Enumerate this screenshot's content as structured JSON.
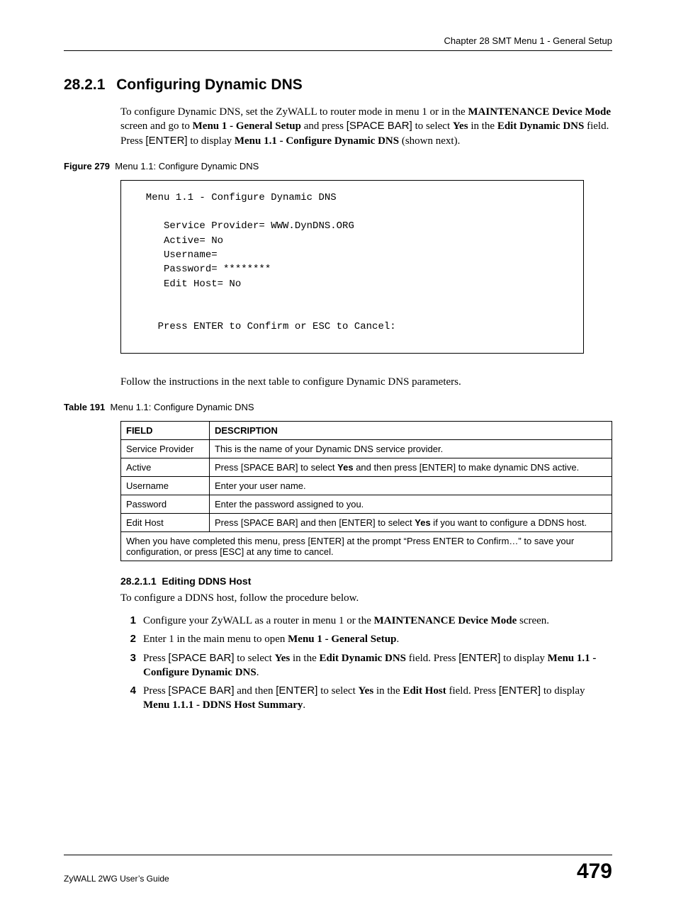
{
  "header": {
    "chapter": "Chapter 28 SMT Menu 1 - General Setup"
  },
  "section": {
    "number": "28.2.1",
    "title": "Configuring Dynamic DNS"
  },
  "intro": {
    "p1a": "To configure Dynamic DNS, set the ZyWALL to router mode in menu 1 or in the ",
    "p1b": "MAINTENANCE Device Mode",
    "p1c": " screen and go to ",
    "p1d": "Menu 1 - General Setup",
    "p1e": " and press ",
    "p1f": "[SPACE BAR]",
    "p1g": " to select ",
    "p1h": "Yes",
    "p1i": " in the ",
    "p1j": "Edit Dynamic DNS",
    "p1k": " field. Press ",
    "p1l": "[ENTER]",
    "p1m": " to display ",
    "p1n": "Menu 1.1 - Configure Dynamic DNS",
    "p1o": " (shown next)."
  },
  "figure": {
    "label": "Figure 279",
    "caption": "Menu 1.1: Configure Dynamic DNS"
  },
  "terminal": "  Menu 1.1 - Configure Dynamic DNS\n\n     Service Provider= WWW.DynDNS.ORG\n     Active= No\n     Username=\n     Password= ********\n     Edit Host= No\n\n\n    Press ENTER to Confirm or ESC to Cancel:",
  "follow": "Follow the instructions in the next table to configure Dynamic DNS parameters.",
  "table": {
    "label": "Table 191",
    "caption": "Menu 1.1: Configure Dynamic DNS",
    "head": {
      "field": "FIELD",
      "desc": "DESCRIPTION"
    },
    "rows": [
      {
        "field": "Service Provider",
        "desc_pre": "This is the name of your Dynamic DNS service provider.",
        "desc_bold": "",
        "desc_post": ""
      },
      {
        "field": "Active",
        "desc_pre": "Press [SPACE BAR] to select ",
        "desc_bold": "Yes",
        "desc_post": " and then press [ENTER] to make dynamic DNS active."
      },
      {
        "field": "Username",
        "desc_pre": "Enter your user name.",
        "desc_bold": "",
        "desc_post": ""
      },
      {
        "field": "Password",
        "desc_pre": "Enter the password assigned to you.",
        "desc_bold": "",
        "desc_post": ""
      },
      {
        "field": "Edit Host",
        "desc_pre": "Press [SPACE BAR] and then [ENTER] to select ",
        "desc_bold": "Yes",
        "desc_post": " if you want to configure a DDNS host."
      }
    ],
    "foot": "When you have completed this menu, press [ENTER] at the prompt “Press ENTER to Confirm…” to save your configuration, or press [ESC] at any time to cancel."
  },
  "sub": {
    "number": "28.2.1.1",
    "title": "Editing DDNS Host",
    "intro": "To configure a DDNS host, follow the procedure below."
  },
  "steps": [
    {
      "n": "1",
      "a": "Configure your ZyWALL as a router in menu 1 or the ",
      "b": "MAINTENANCE Device Mode",
      "c": " screen."
    },
    {
      "n": "2",
      "a": "Enter 1 in the main menu to open ",
      "b": "Menu 1 - General Setup",
      "c": "."
    },
    {
      "n": "3",
      "a": "Press ",
      "sb": "[SPACE BAR]",
      "b2": " to select ",
      "bold1": "Yes",
      "c2": " in the ",
      "bold2": "Edit Dynamic DNS",
      "d": " field. Press ",
      "en": "[ENTER]",
      "e": " to display ",
      "bold3": "Menu 1.1 - Configure Dynamic DNS",
      "f": "."
    },
    {
      "n": "4",
      "a": "Press ",
      "sb": "[SPACE BAR]",
      "b2": " and then ",
      "en": "[ENTER]",
      "c2": " to select ",
      "bold1": "Yes",
      "d": " in the ",
      "bold2": "Edit Host",
      "e": " field. Press ",
      "en2": "[ENTER]",
      "f": " to display ",
      "bold3": "Menu 1.1.1 - DDNS Host Summary",
      "g": "."
    }
  ],
  "footer": {
    "guide": "ZyWALL 2WG User’s Guide",
    "page": "479"
  }
}
